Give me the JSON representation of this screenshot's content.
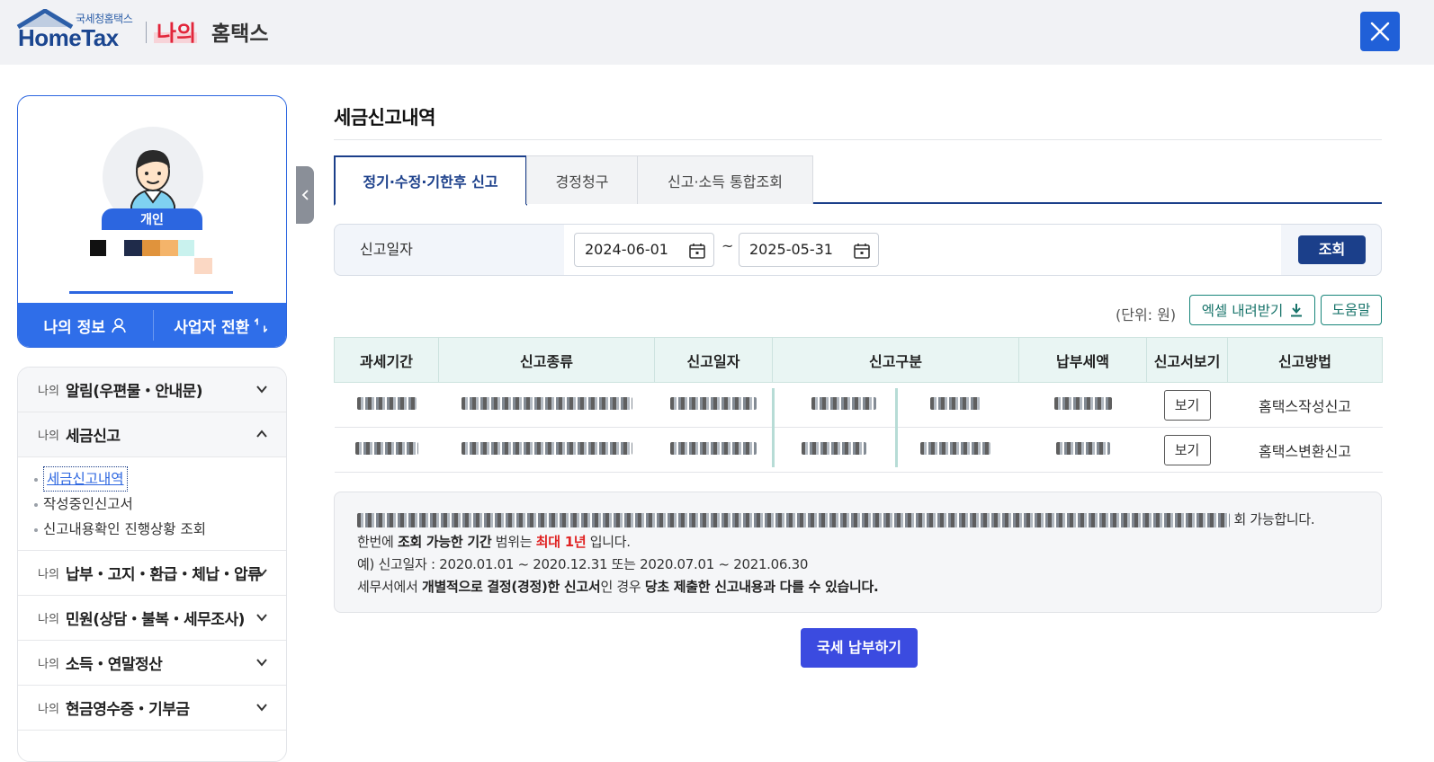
{
  "header": {
    "logo_sub": "국세청홈택스",
    "logo_main": "HomeTax",
    "my_label": "나의",
    "service_label": "홈택스",
    "close_icon": "close-icon"
  },
  "profile": {
    "type_badge": "개인",
    "my_info_label": "나의 정보",
    "switch_label": "사업자 전환"
  },
  "menu": {
    "prefix": "나의",
    "items": [
      {
        "label": "알림(우편물・안내문)",
        "state": "collapsed"
      },
      {
        "label": "세금신고",
        "state": "expanded"
      },
      {
        "label": "납부・고지・환급・체납・압류",
        "state": "collapsed"
      },
      {
        "label": "민원(상담・불복・세무조사)",
        "state": "collapsed"
      },
      {
        "label": "소득・연말정산",
        "state": "collapsed"
      },
      {
        "label": "현금영수증・기부금",
        "state": "collapsed"
      }
    ],
    "submenu": [
      "세금신고내역",
      "작성중인신고서",
      "신고내용확인 진행상황 조회"
    ]
  },
  "main": {
    "title": "세금신고내역",
    "tabs": [
      "정기·수정·기한후 신고",
      "경정청구",
      "신고·소득 통합조회"
    ],
    "search": {
      "label": "신고일자",
      "date_from": "2024-06-01",
      "separator": "~",
      "date_to": "2025-05-31",
      "button": "조회"
    },
    "unit": "(단위: 원)",
    "excel_button": "엑셀 내려받기",
    "help_button": "도움말",
    "table": {
      "headers": [
        "과세기간",
        "신고종류",
        "신고일자",
        "신고구분",
        "납부세액",
        "신고서보기",
        "신고방법"
      ],
      "rows": [
        {
          "view": "보기",
          "method": "홈택스작성신고"
        },
        {
          "view": "보기",
          "method": "홈택스변환신고"
        }
      ]
    },
    "notice": {
      "line1_tail": "회 가능합니다.",
      "line2_a": "한번에 ",
      "line2_b": "조회 가능한 기간",
      "line2_c": " 범위는 ",
      "line2_d": "최대 1년",
      "line2_e": " 입니다.",
      "line3": "예) 신고일자 : 2020.01.01 ~ 2020.12.31 또는 2020.07.01 ~ 2021.06.30",
      "line4_a": "세무서에서 ",
      "line4_b": "개별적으로 결정(경정)한 신고서",
      "line4_c": "인 경우 ",
      "line4_d": "당초 제출한 신고내용과 다를 수 있습니다."
    },
    "pay_button": "국세 납부하기"
  },
  "colors": {
    "brand_blue": "#2c66e0",
    "navy": "#1b3f8a",
    "teal": "#18857a",
    "pay_button": "#3b4be0",
    "alert_red": "#e02424"
  }
}
